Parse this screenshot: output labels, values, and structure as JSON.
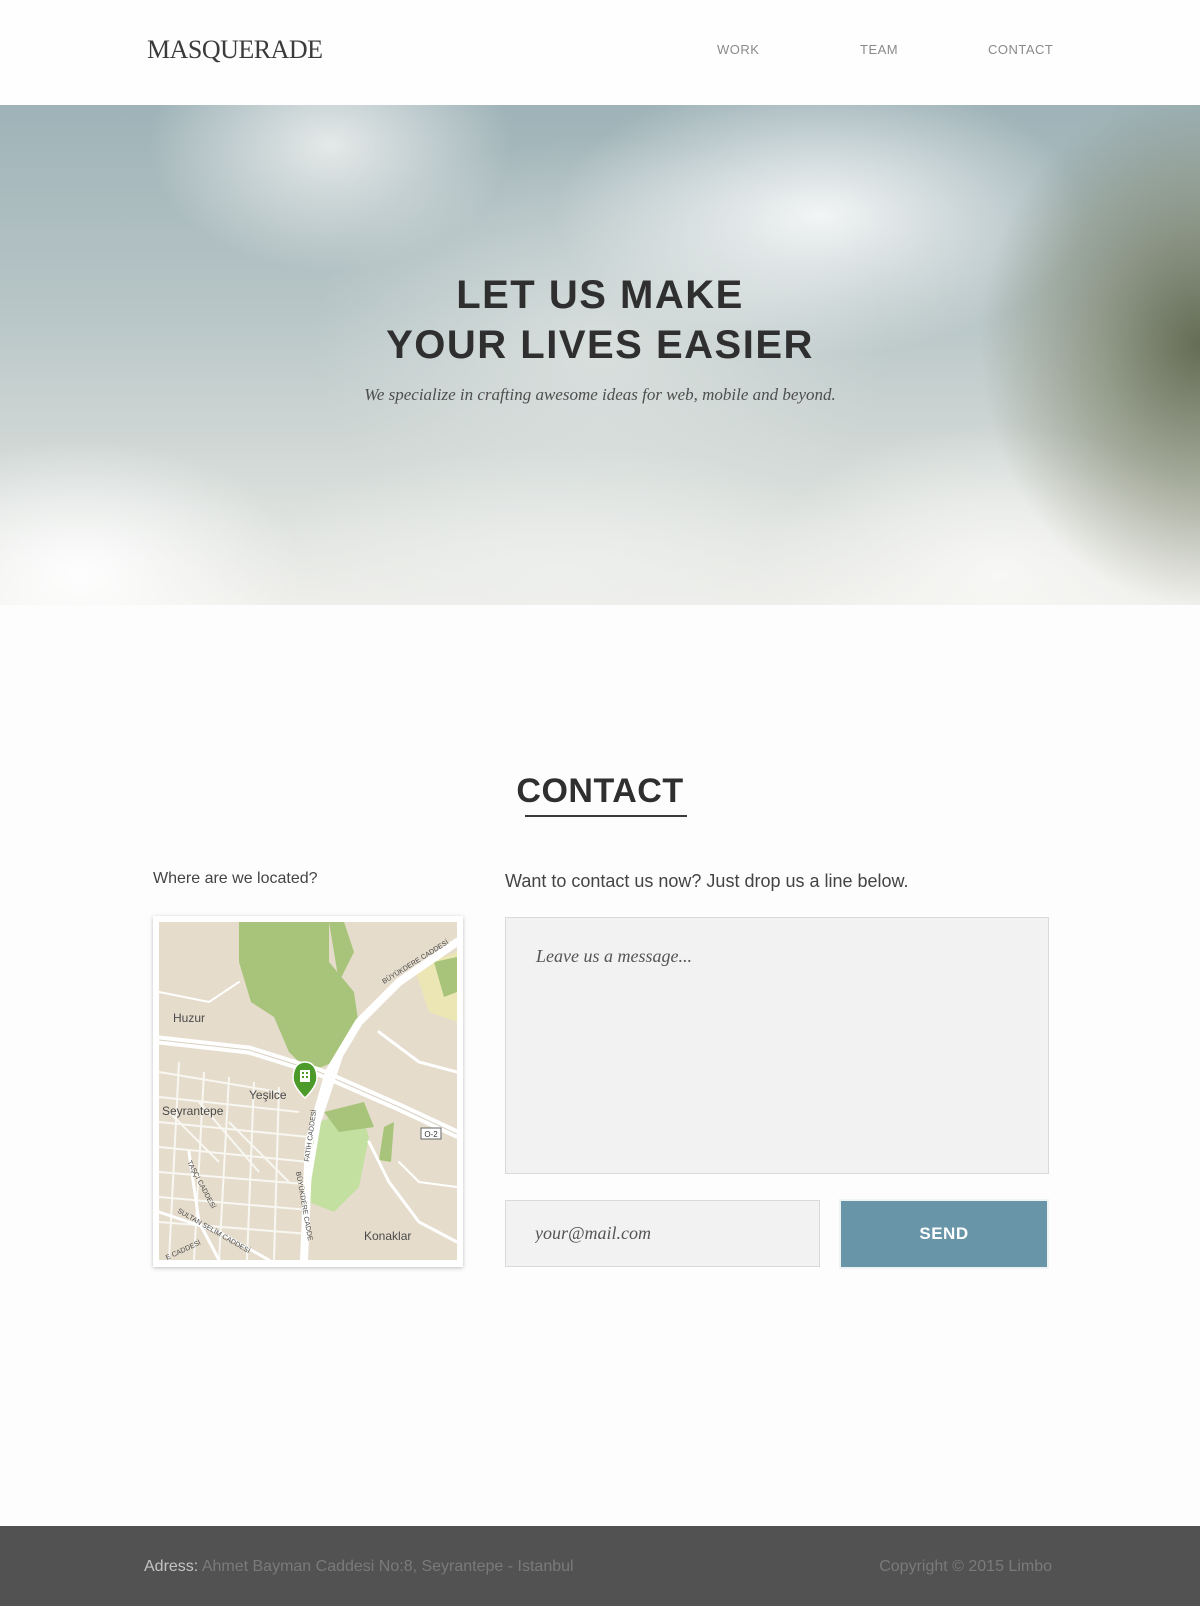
{
  "header": {
    "logo": "MASQUERADE",
    "nav": [
      "WORK",
      "TEAM",
      "CONTACT"
    ]
  },
  "hero": {
    "title_line1": "LET US MAKE",
    "title_line2": "YOUR LIVES EASIER",
    "subtitle": "We specialize in crafting awesome ideas for web, mobile and beyond."
  },
  "contact": {
    "title": "CONTACT",
    "location_label": "Where are we located?",
    "form_label": "Want to contact us now? Just drop us a line below.",
    "message_placeholder": "Leave us a message...",
    "email_placeholder": "your@mail.com",
    "send_label": "SEND"
  },
  "map": {
    "labels": [
      "Huzur",
      "Yeşilce",
      "Seyrantepe",
      "Konaklar",
      "O-2",
      "BÜYÜKDERE CADDESİ",
      "FATİH CADDESİ",
      "BÜYÜKDERE CADDE",
      "TAŞÇI CADDESİ",
      "SULTAN SELİM CADDESİ",
      "E CADDESİ"
    ]
  },
  "footer": {
    "address_label": "Adress:",
    "address_text": " Ahmet Bayman Caddesi No:8, Seyrantepe - Istanbul",
    "copyright": "Copyright © 2015 Limbo"
  },
  "colors": {
    "accent": "#6995a8",
    "footer_bg": "#525252",
    "map_pin": "#4c9a2a"
  }
}
